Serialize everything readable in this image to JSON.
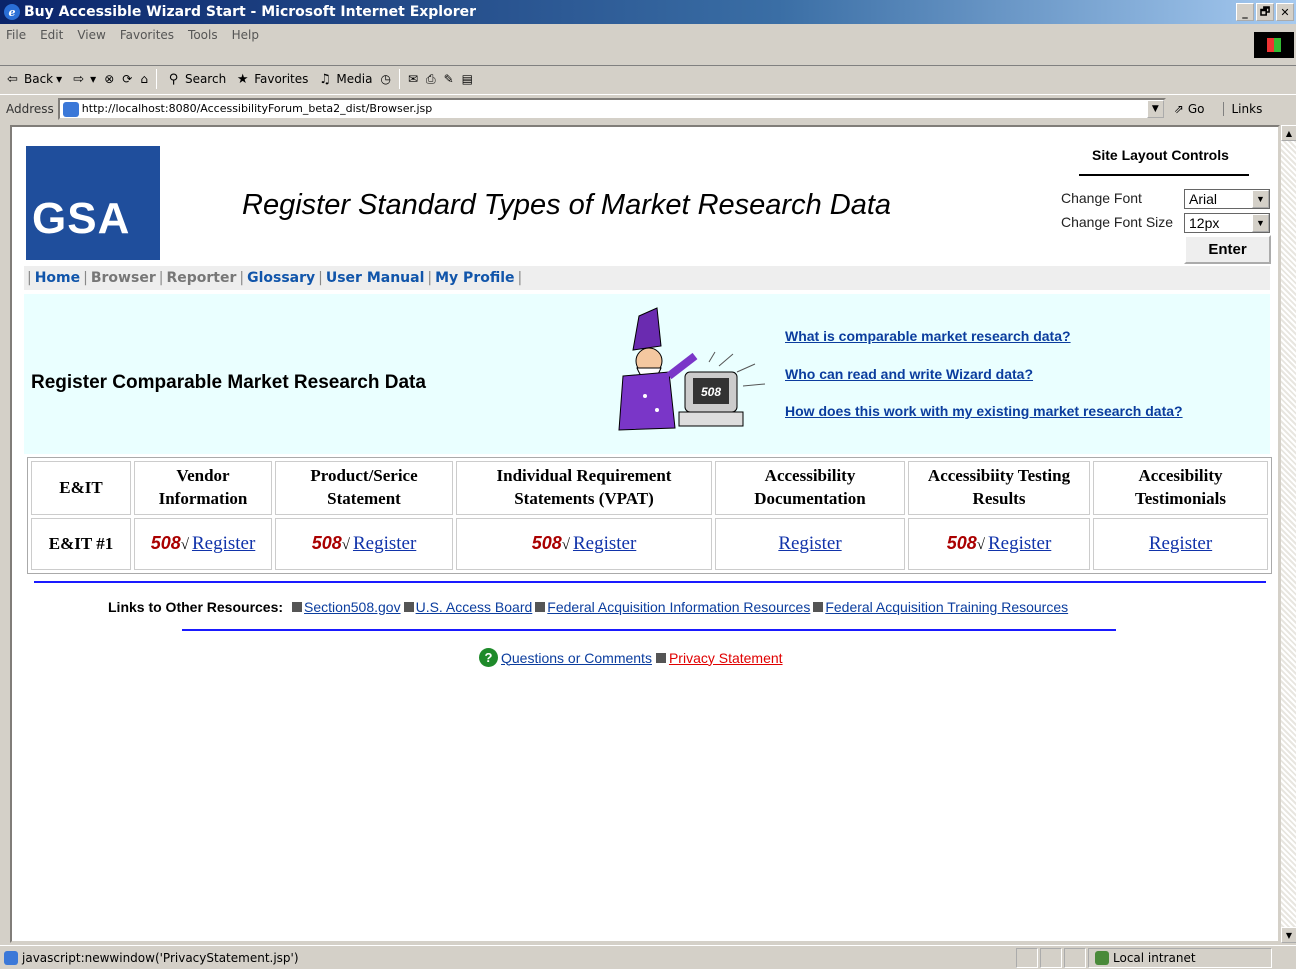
{
  "window": {
    "title": "Buy Accessible Wizard Start - Microsoft Internet Explorer",
    "controls": [
      "_",
      "🗗",
      "✕"
    ]
  },
  "menu": [
    "File",
    "Edit",
    "View",
    "Favorites",
    "Tools",
    "Help"
  ],
  "toolbar": {
    "back": "Back",
    "search": "Search",
    "favorites": "Favorites",
    "media": "Media"
  },
  "address": {
    "label": "Address",
    "url": "http://localhost:8080/AccessibilityForum_beta2_dist/Browser.jsp",
    "go": "Go",
    "links": "Links"
  },
  "header": {
    "logo_text": "GSA",
    "title": "Register Standard Types of Market Research Data"
  },
  "site_layout": {
    "title": "Site Layout Controls",
    "font_label": "Change Font",
    "font_value": "Arial",
    "size_label": "Change Font Size",
    "size_value": "12px",
    "enter": "Enter"
  },
  "nav": [
    {
      "label": "Home",
      "active": true
    },
    {
      "label": "Browser",
      "active": false
    },
    {
      "label": "Reporter",
      "active": false
    },
    {
      "label": "Glossary",
      "active": true
    },
    {
      "label": "User Manual",
      "active": true
    },
    {
      "label": "My Profile",
      "active": true
    }
  ],
  "banner": {
    "title": "Register Comparable Market Research Data",
    "badge": "508",
    "links": [
      "What is comparable market research data?",
      "Who can read and write Wizard data?",
      "How does this work with my existing market research data?"
    ]
  },
  "grid": {
    "headers": [
      "E&IT",
      "Vendor Information",
      "Product/Serice Statement",
      "Individual Requirement Statements (VPAT)",
      "Accessibility Documentation",
      "Accessibiity Testing Results",
      "Accesibility Testimonials"
    ],
    "row_label": "E&IT #1",
    "badge": "508",
    "check": "√",
    "register": "Register"
  },
  "resources": {
    "label": "Links to Other Resources:",
    "links": [
      "Section508.gov",
      "U.S. Access Board",
      "Federal Acquisition Information Resources",
      "Federal Acquisition Training Resources"
    ]
  },
  "footer": {
    "questions": "Questions or Comments",
    "privacy": "Privacy Statement"
  },
  "status": {
    "text": "javascript:newwindow('PrivacyStatement.jsp')",
    "zone": "Local intranet"
  }
}
